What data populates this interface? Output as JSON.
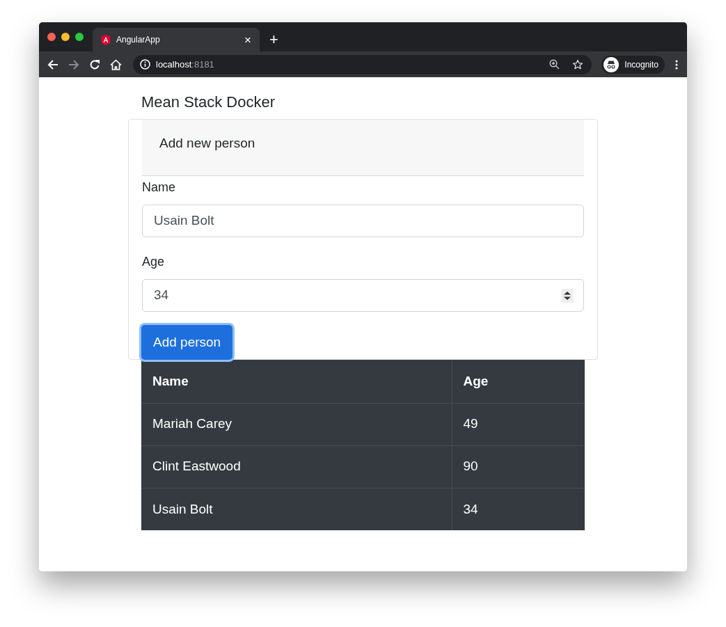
{
  "browser": {
    "tab": {
      "title": "AngularApp",
      "close": "×"
    },
    "new_tab": "+",
    "address": {
      "host": "localhost",
      "port": ":8181"
    },
    "profile": "Incognito"
  },
  "page": {
    "heading": "Mean Stack Docker",
    "card": {
      "title": "Add new person",
      "fields": [
        {
          "label": "Name",
          "value": "Usain Bolt",
          "kind": "text"
        },
        {
          "label": "Age",
          "value": "34",
          "kind": "number"
        }
      ],
      "button": {
        "label": "Add person",
        "focused": true
      }
    },
    "table": {
      "columns": [
        "Name",
        "Age"
      ],
      "rows": [
        [
          "Mariah Carey",
          "49"
        ],
        [
          "Clint Eastwood",
          "90"
        ],
        [
          "Usain Bolt",
          "34"
        ]
      ]
    }
  }
}
